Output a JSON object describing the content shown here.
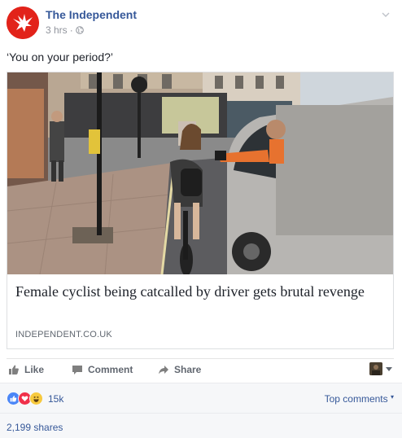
{
  "post": {
    "page_name": "The Independent",
    "timestamp": "3 hrs",
    "separator": "·",
    "status_text": "‘You on your period?’"
  },
  "link": {
    "title": "Female cyclist being catcalled by driver gets brutal revenge",
    "domain": "INDEPENDENT.CO.UK"
  },
  "actions": {
    "like_label": "Like",
    "comment_label": "Comment",
    "share_label": "Share"
  },
  "reactions": {
    "icons": [
      "like-icon",
      "love-icon",
      "haha-icon"
    ],
    "count": "15k",
    "sort_label": "Top comments",
    "shares": "2,199 shares"
  },
  "colors": {
    "brand_red": "#e2231a",
    "link_blue": "#365899",
    "like_blue": "#4a86f7",
    "love_red": "#f0304a",
    "haha_yellow": "#f7c93d"
  }
}
